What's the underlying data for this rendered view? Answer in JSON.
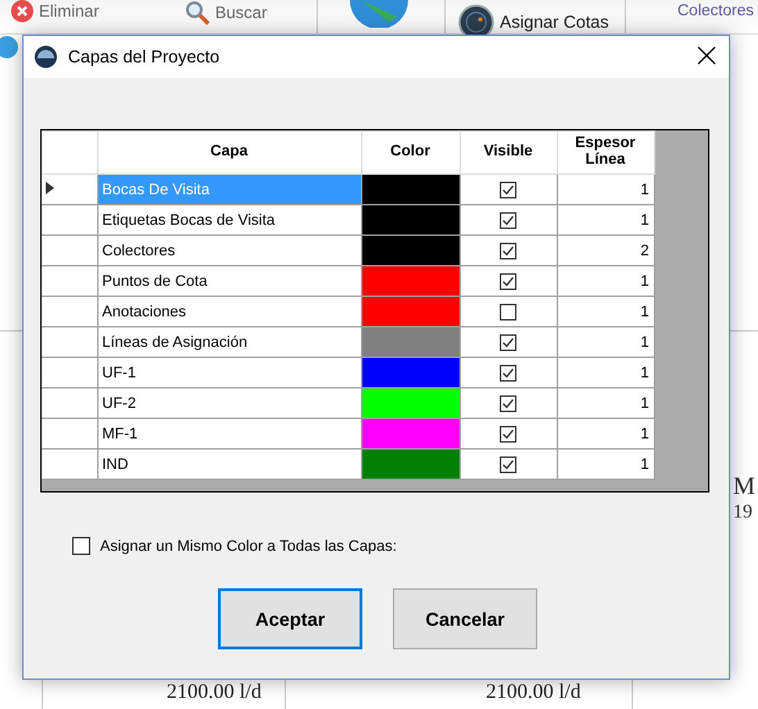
{
  "background": {
    "toolbar": [
      {
        "label": "Eliminar",
        "kind": "delete"
      },
      {
        "label": "Buscar",
        "kind": "search"
      },
      {
        "label": "Asignar Cotas",
        "kind": "radar"
      },
      {
        "label": "Colectores",
        "kind": "plain"
      }
    ],
    "side_labels": [
      "M",
      "19"
    ],
    "flow_labels": [
      "2100.00 l/d",
      "2100.00 l/d"
    ]
  },
  "dialog": {
    "title": "Capas del Proyecto",
    "table": {
      "columns": [
        "Capa",
        "Color",
        "Visible",
        "Espesor Línea"
      ],
      "rows": [
        {
          "capa": "Bocas De Visita",
          "color": "#000000",
          "visible": true,
          "espesor": "1",
          "selected": true
        },
        {
          "capa": "Etiquetas Bocas de Visita",
          "color": "#000000",
          "visible": true,
          "espesor": "1",
          "selected": false
        },
        {
          "capa": "Colectores",
          "color": "#000000",
          "visible": true,
          "espesor": "2",
          "selected": false
        },
        {
          "capa": "Puntos de Cota",
          "color": "#ff0000",
          "visible": true,
          "espesor": "1",
          "selected": false
        },
        {
          "capa": "Anotaciones",
          "color": "#ff0000",
          "visible": false,
          "espesor": "1",
          "selected": false
        },
        {
          "capa": "Líneas de Asignación",
          "color": "#808080",
          "visible": true,
          "espesor": "1",
          "selected": false
        },
        {
          "capa": "UF-1",
          "color": "#0000ff",
          "visible": true,
          "espesor": "1",
          "selected": false
        },
        {
          "capa": "UF-2",
          "color": "#00ff00",
          "visible": true,
          "espesor": "1",
          "selected": false
        },
        {
          "capa": "MF-1",
          "color": "#ff00ff",
          "visible": true,
          "espesor": "1",
          "selected": false
        },
        {
          "capa": "IND",
          "color": "#008000",
          "visible": true,
          "espesor": "1",
          "selected": false
        }
      ]
    },
    "same_color": {
      "label": "Asignar un Mismo Color a Todas las Capas:",
      "checked": false
    },
    "buttons": [
      {
        "label": "Aceptar",
        "default": true
      },
      {
        "label": "Cancelar",
        "default": false
      }
    ]
  }
}
